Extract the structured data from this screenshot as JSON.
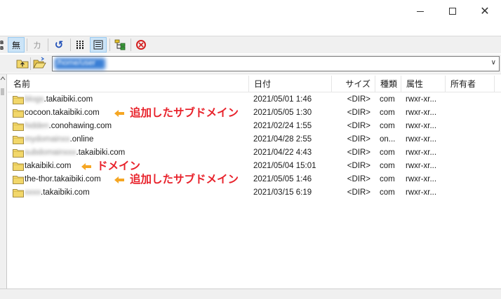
{
  "titlebar": {
    "minimize_icon": "minimize-icon",
    "maximize_icon": "maximize-icon",
    "close_glyph": "✕"
  },
  "toolbar": {
    "items": [
      {
        "icon": "binary-mode-icon",
        "label": ""
      },
      {
        "icon": "no-conversion-icon",
        "label": "無"
      },
      {
        "icon": "katakana-icon",
        "label": "カ"
      },
      {
        "icon": "refresh-icon",
        "label": "↺"
      },
      {
        "icon": "list-view-icon",
        "label": ""
      },
      {
        "icon": "details-view-icon",
        "label": ""
      },
      {
        "icon": "tree-view-icon",
        "label": ""
      },
      {
        "icon": "stop-icon",
        "label": ""
      }
    ]
  },
  "pathbar": {
    "up_icon": "parent-folder-icon",
    "open_icon": "open-folder-icon",
    "path_value": "/home/user"
  },
  "columns": {
    "name": "名前",
    "date": "日付",
    "size": "サイズ",
    "type": "種類",
    "attr": "属性",
    "owner": "所有者"
  },
  "files": [
    {
      "blurred_prefix": "blogs",
      "name": ".takaibiki.com",
      "date": "2021/05/01  1:46",
      "size": "<DIR>",
      "type": "com",
      "attr": "rwxr-xr..."
    },
    {
      "blurred_prefix": "",
      "name": "cocoon.takaibiki.com",
      "date": "2021/05/05  1:30",
      "size": "<DIR>",
      "type": "com",
      "attr": "rwxr-xr..."
    },
    {
      "blurred_prefix": "hidden",
      "name": ".conohawing.com",
      "date": "2021/02/24  1:55",
      "size": "<DIR>",
      "type": "com",
      "attr": "rwxr-xr..."
    },
    {
      "blurred_prefix": "mydomainxx",
      "name": ".online",
      "date": "2021/04/28  2:55",
      "size": "<DIR>",
      "type": "on...",
      "attr": "rwxr-xr..."
    },
    {
      "blurred_prefix": "subdomainxxx",
      "name": ".takaibiki.com",
      "date": "2021/04/22  4:43",
      "size": "<DIR>",
      "type": "com",
      "attr": "rwxr-xr..."
    },
    {
      "blurred_prefix": "",
      "name": "takaibiki.com",
      "date": "2021/05/04 15:01",
      "size": "<DIR>",
      "type": "com",
      "attr": "rwxr-xr..."
    },
    {
      "blurred_prefix": "",
      "name": "the-thor.takaibiki.com",
      "date": "2021/05/05  1:46",
      "size": "<DIR>",
      "type": "com",
      "attr": "rwxr-xr..."
    },
    {
      "blurred_prefix": "xxxx",
      "name": ".takaibiki.com",
      "date": "2021/03/15  6:19",
      "size": "<DIR>",
      "type": "com",
      "attr": "rwxr-xr..."
    }
  ],
  "annotations": [
    {
      "row": 1,
      "text": "追加したサブドメイン",
      "color": "#e8222b"
    },
    {
      "row": 5,
      "text": "ドメイン",
      "color": "#e8222b"
    },
    {
      "row": 6,
      "text": "追加したサブドメイン",
      "color": "#e8222b"
    }
  ],
  "colors": {
    "arrow": "#f5a623",
    "annotation_text": "#e8222b",
    "folder_fill": "#f2d76a",
    "pressed_button": "#cce4f7"
  }
}
